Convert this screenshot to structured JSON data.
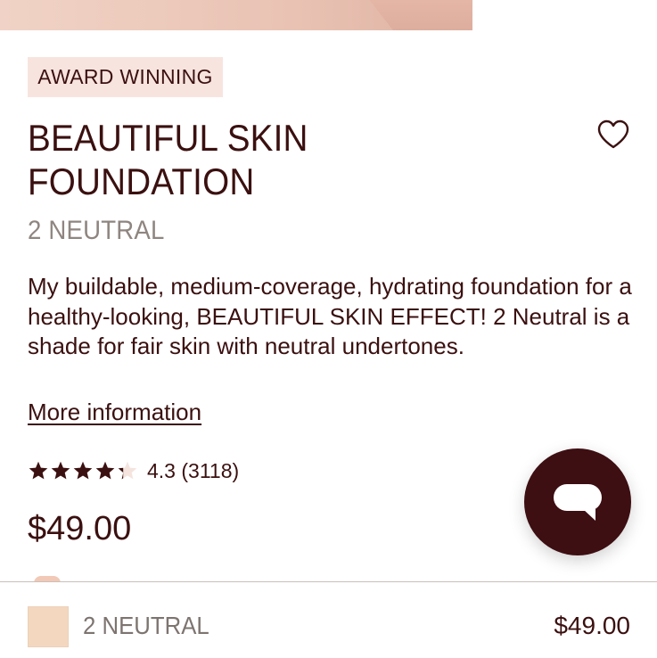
{
  "product": {
    "badge": "AWARD WINNING",
    "title_line1": "BEAUTIFUL SKIN",
    "title_line2": "FOUNDATION",
    "shade": "2 NEUTRAL",
    "description": "My buildable, medium-coverage, hydrating foundation for a healthy-looking, BEAUTIFUL SKIN EFFECT! 2 Neutral is a shade for fair skin with neutral undertones.",
    "more_info_label": "More information",
    "rating_value": "4.3",
    "rating_count": "(3118)",
    "price": "$49.00"
  },
  "rating_stars": {
    "rating": 4.3,
    "max": 5
  },
  "sticky_bar": {
    "shade": "2 NEUTRAL",
    "price": "$49.00",
    "swatch_color": "#f3d8bf"
  },
  "colors": {
    "brand_dark": "#3d0e12",
    "text_primary": "#3b1010",
    "text_muted": "#8f8580",
    "badge_bg": "#f8e4df"
  },
  "icons": {
    "wishlist": "heart-outline-icon",
    "chat": "chat-bubble-icon"
  }
}
